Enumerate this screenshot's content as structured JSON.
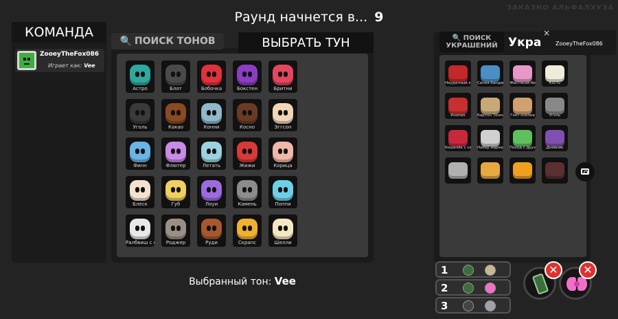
{
  "round": {
    "prefix": "Раунд начнется в...",
    "number": "9"
  },
  "faded_topright": "ЗАКАЗНО АЛЬФАЛХУЗА",
  "team": {
    "title": "КОМАНДА",
    "player": {
      "name": "ZooeyTheFox086",
      "plays_as_label": "Играет как:",
      "plays_as_value": "Vee"
    }
  },
  "toon_search": {
    "placeholder": "ПОИСК ТОНОВ"
  },
  "select_toon": {
    "title": "ВЫБРАТЬ ТУН"
  },
  "toons": [
    {
      "name": "Астро",
      "color": "#2fa8a0"
    },
    {
      "name": "Блот",
      "color": "#4a4a4a"
    },
    {
      "name": "Бобочка",
      "color": "#e0313c"
    },
    {
      "name": "Бокстен",
      "color": "#8b3dc4"
    },
    {
      "name": "Бритни",
      "color": "#e5465f"
    },
    {
      "name": "Уголь",
      "color": "#3a3a3a"
    },
    {
      "name": "Какао",
      "color": "#8a4a22"
    },
    {
      "name": "Конни",
      "color": "#8fb8c8"
    },
    {
      "name": "Косно",
      "color": "#6a3b24"
    },
    {
      "name": "Эггсон",
      "color": "#f2d6b8"
    },
    {
      "name": "Финн",
      "color": "#6ab4e6"
    },
    {
      "name": "Флютер",
      "color": "#c98ae8"
    },
    {
      "name": "Летать",
      "color": "#9cd2e0"
    },
    {
      "name": "Жижи",
      "color": "#d63a3a"
    },
    {
      "name": "Корица",
      "color": "#f0b8a8"
    },
    {
      "name": "Блеск",
      "color": "#f4e2d0"
    },
    {
      "name": "Губ",
      "color": "#f0d060"
    },
    {
      "name": "Лоуи",
      "color": "#9c6be0"
    },
    {
      "name": "Камень",
      "color": "#8c8c8c"
    },
    {
      "name": "Поппи",
      "color": "#6ed0e8"
    },
    {
      "name": "Ралбвиш с северным",
      "color": "#e8e8e8"
    },
    {
      "name": "Роджер",
      "color": "#9a8f86"
    },
    {
      "name": "Руди",
      "color": "#a5582d"
    },
    {
      "name": "Скрапс",
      "color": "#f0b030"
    },
    {
      "name": "Шелли",
      "color": "#f4e8c4"
    }
  ],
  "selected": {
    "label": "Выбранный тон:",
    "value": "Vee"
  },
  "acc_search": {
    "line1": "ПОИСК",
    "line2": "УКРАШЕНИЙ"
  },
  "acc_title": "Украш",
  "tooltip": {
    "close": "×",
    "name": "ZooeyTheFox086"
  },
  "accessories": [
    {
      "name": "Неудачный кошелёк",
      "color": "#c42828"
    },
    {
      "name": "Синяя бандана",
      "color": "#4a8fc4"
    },
    {
      "name": "Жестяная бита",
      "color": "#e898c8"
    },
    {
      "name": "Кость",
      "color": "#f0ecdc"
    },
    {
      "name": "Кнопик",
      "color": "#c82f2f"
    },
    {
      "name": "Картон Тонная?",
      "color": "#c8a878"
    },
    {
      "name": "Гонг-хлопка",
      "color": "#d0a070"
    },
    {
      "name": "Уголь",
      "color": "#888888"
    },
    {
      "name": "Кошелёк с сердцем",
      "color": "#c8283c"
    },
    {
      "name": "Набор маркеров",
      "color": "#d0d0d0"
    },
    {
      "name": "Поход с друзьями",
      "color": "#60c060"
    },
    {
      "name": "Дневник",
      "color": "#8050b0"
    },
    {
      "name": "",
      "color": "#b0b0b0"
    },
    {
      "name": "",
      "color": "#e8a840"
    },
    {
      "name": "",
      "color": "#f0a020"
    },
    {
      "name": "",
      "color": "#5a3030"
    }
  ],
  "slots": [
    {
      "num": "1",
      "icon1": "#3c6e3c",
      "icon2": "#c8b890"
    },
    {
      "num": "2",
      "icon1": "#3c6e3c",
      "icon2": "#f070c8"
    },
    {
      "num": "3",
      "icon1": "#444444",
      "icon2": "#a0a0a8"
    }
  ],
  "equipped": {
    "remove": "✕"
  },
  "icons": {
    "search": "search-icon",
    "camera": "camera-icon"
  }
}
